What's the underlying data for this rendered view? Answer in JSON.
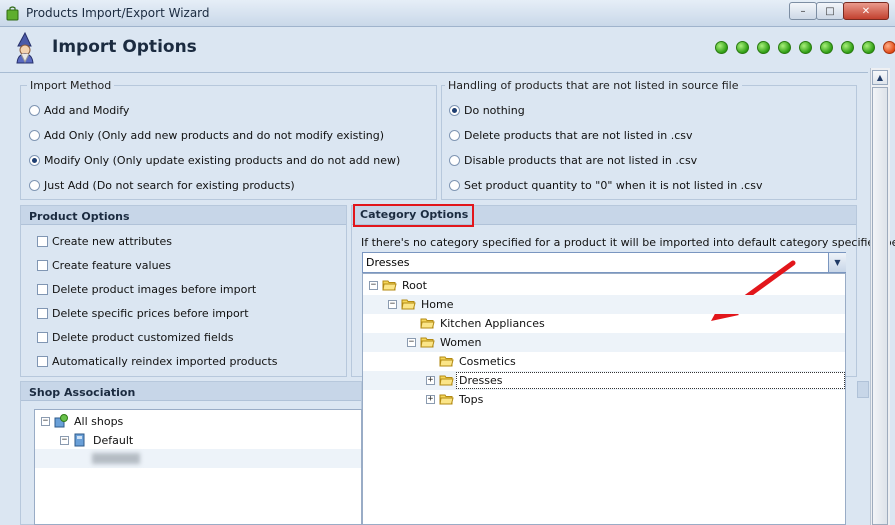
{
  "window": {
    "title": "Products Import/Export Wizard",
    "controls": {
      "minimize": "–",
      "maximize": "□",
      "close": "✕"
    }
  },
  "header": {
    "title": "Import Options",
    "progress": {
      "total": 9,
      "completed": 7,
      "current": 8,
      "colors": {
        "done": "#2f9e14",
        "current": "#e04a16"
      }
    }
  },
  "import_method": {
    "legend": "Import Method",
    "options": [
      {
        "label": "Add and Modify",
        "selected": false
      },
      {
        "label": "Add Only (Only add new products and do not modify existing)",
        "selected": false
      },
      {
        "label": "Modify Only (Only update existing products and do not add new)",
        "selected": true
      },
      {
        "label": "Just Add (Do not search for existing products)",
        "selected": false
      }
    ]
  },
  "unlisted_handling": {
    "legend": "Handling of products that are not listed in source file",
    "options": [
      {
        "label": "Do nothing",
        "selected": true
      },
      {
        "label": "Delete products that are not listed in .csv",
        "selected": false
      },
      {
        "label": "Disable products that are not listed in .csv",
        "selected": false
      },
      {
        "label": "Set product quantity to \"0\" when it is not listed in .csv",
        "selected": false
      }
    ]
  },
  "product_options": {
    "title": "Product Options",
    "items": [
      {
        "label": "Create new attributes",
        "checked": false
      },
      {
        "label": "Create feature values",
        "checked": false
      },
      {
        "label": "Delete product images before import",
        "checked": false
      },
      {
        "label": "Delete specific prices before import",
        "checked": false
      },
      {
        "label": "Delete product customized fields",
        "checked": false
      },
      {
        "label": "Automatically reindex imported products",
        "checked": false
      }
    ]
  },
  "category_options": {
    "title": "Category Options",
    "description": "If there's no category specified for a product it will be imported into default category specified below",
    "selected": "Dresses",
    "tree": [
      {
        "label": "Root",
        "expander": "−"
      },
      {
        "label": "Home",
        "expander": "−"
      },
      {
        "label": "Kitchen Appliances",
        "expander": ""
      },
      {
        "label": "Women",
        "expander": "−"
      },
      {
        "label": "Cosmetics",
        "expander": ""
      },
      {
        "label": "Dresses",
        "expander": "+",
        "selected": true
      },
      {
        "label": "Tops",
        "expander": "+"
      }
    ]
  },
  "shop_association": {
    "title": "Shop Association",
    "tree": [
      {
        "label": "All shops",
        "expander": "−"
      },
      {
        "label": "Default",
        "expander": "−"
      }
    ]
  },
  "annotation": {
    "color": "#e2161b",
    "icon": "red-arrow"
  }
}
